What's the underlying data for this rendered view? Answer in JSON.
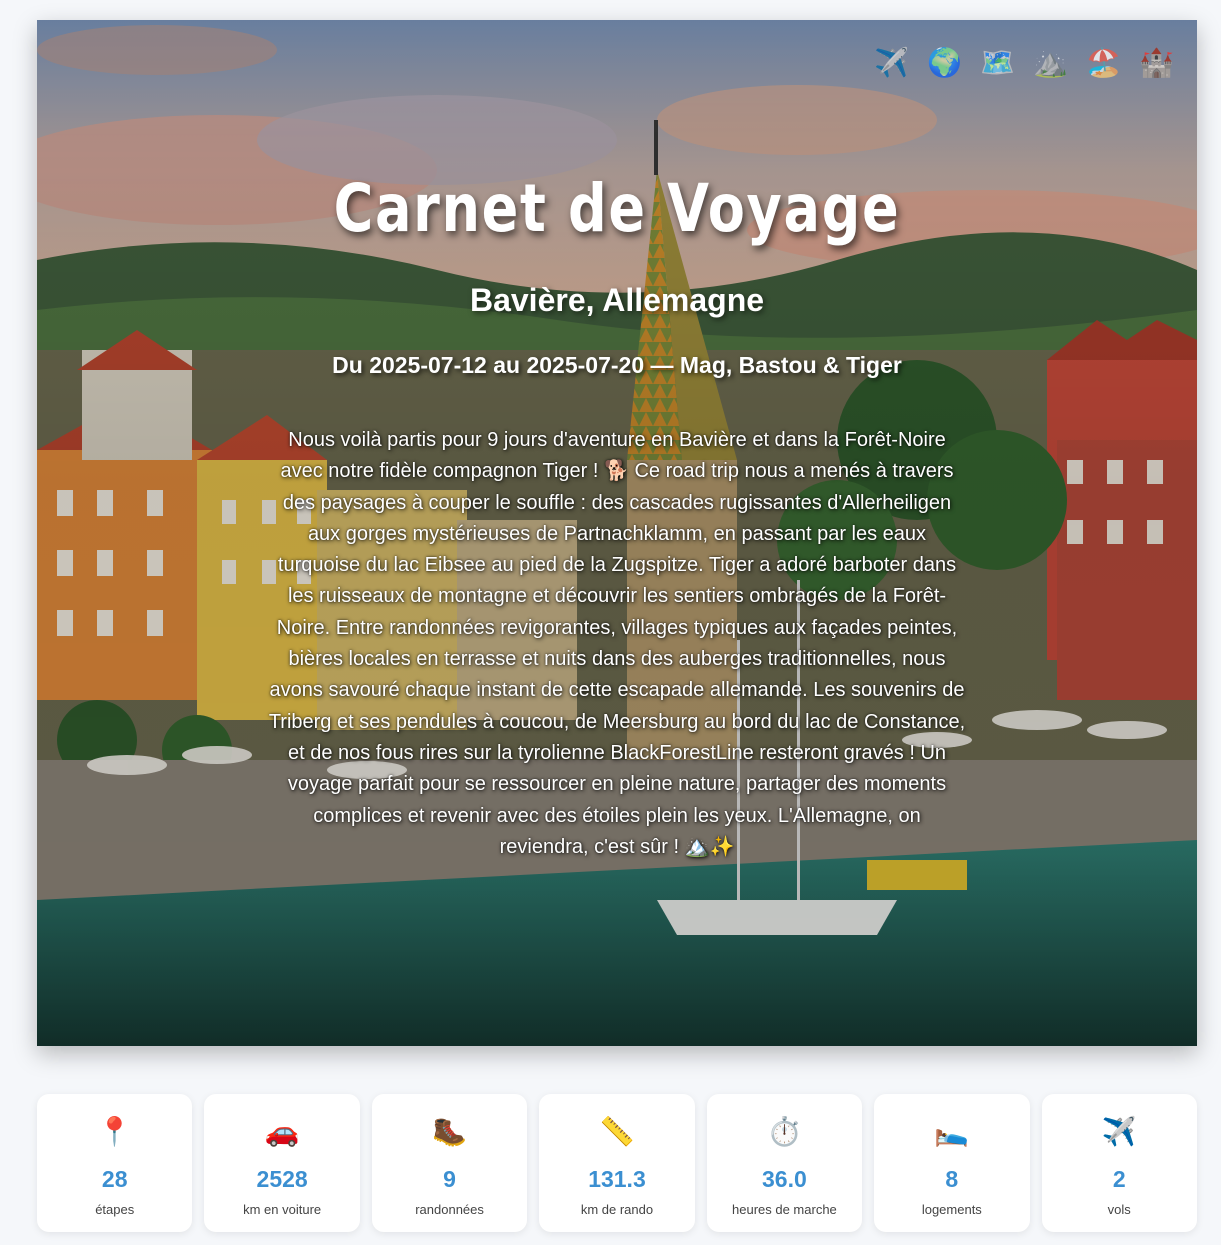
{
  "header": {
    "icons": [
      {
        "name": "airplane-icon",
        "glyph": "✈️"
      },
      {
        "name": "globe-icon",
        "glyph": "🌍"
      },
      {
        "name": "map-icon",
        "glyph": "🗺️"
      },
      {
        "name": "mountain-icon",
        "glyph": "⛰️"
      },
      {
        "name": "beach-umbrella-icon",
        "glyph": "🏖️"
      },
      {
        "name": "castle-icon",
        "glyph": "🏰"
      }
    ]
  },
  "hero": {
    "title": "Carnet de Voyage",
    "subtitle": "Bavière, Allemagne",
    "dates": "Du 2025-07-12 au 2025-07-20 — Mag, Bastou & Tiger",
    "description": "Nous voilà partis pour 9 jours d'aventure en Bavière et dans la Forêt-Noire avec notre fidèle compagnon Tiger ! 🐕 Ce road trip nous a menés à travers des paysages à couper le souffle : des cascades rugissantes d'Allerheiligen aux gorges mystérieuses de Partnachklamm, en passant par les eaux turquoise du lac Eibsee au pied de la Zugspitze. Tiger a adoré barboter dans les ruisseaux de montagne et découvrir les sentiers ombragés de la Forêt-Noire. Entre randonnées revigorantes, villages typiques aux façades peintes, bières locales en terrasse et nuits dans des auberges traditionnelles, nous avons savouré chaque instant de cette escapade allemande. Les souvenirs de Triberg et ses pendules à coucou, de Meersburg au bord du lac de Constance, et de nos fous rires sur la tyrolienne BlackForestLine resteront gravés ! Un voyage parfait pour se ressourcer en pleine nature, partager des moments complices et revenir avec des étoiles plein les yeux. L'Allemagne, on reviendra, c'est sûr ! 🏔️✨"
  },
  "stats": [
    {
      "icon": "pin-icon",
      "glyph": "📍",
      "value": "28",
      "label": "étapes"
    },
    {
      "icon": "car-icon",
      "glyph": "🚗",
      "value": "2528",
      "label": "km en voiture"
    },
    {
      "icon": "hiking-boot-icon",
      "glyph": "🥾",
      "value": "9",
      "label": "randonnées"
    },
    {
      "icon": "ruler-icon",
      "glyph": "📏",
      "value": "131.3",
      "label": "km de rando"
    },
    {
      "icon": "stopwatch-icon",
      "glyph": "⏱️",
      "value": "36.0",
      "label": "heures de marche"
    },
    {
      "icon": "bed-icon",
      "glyph": "🛌",
      "value": "8",
      "label": "logements"
    },
    {
      "icon": "airplane-icon",
      "glyph": "✈️",
      "value": "2",
      "label": "vols"
    }
  ],
  "colors": {
    "accent": "#3b8fd1",
    "page_background": "#f5f7fa",
    "card_background": "#ffffff"
  }
}
